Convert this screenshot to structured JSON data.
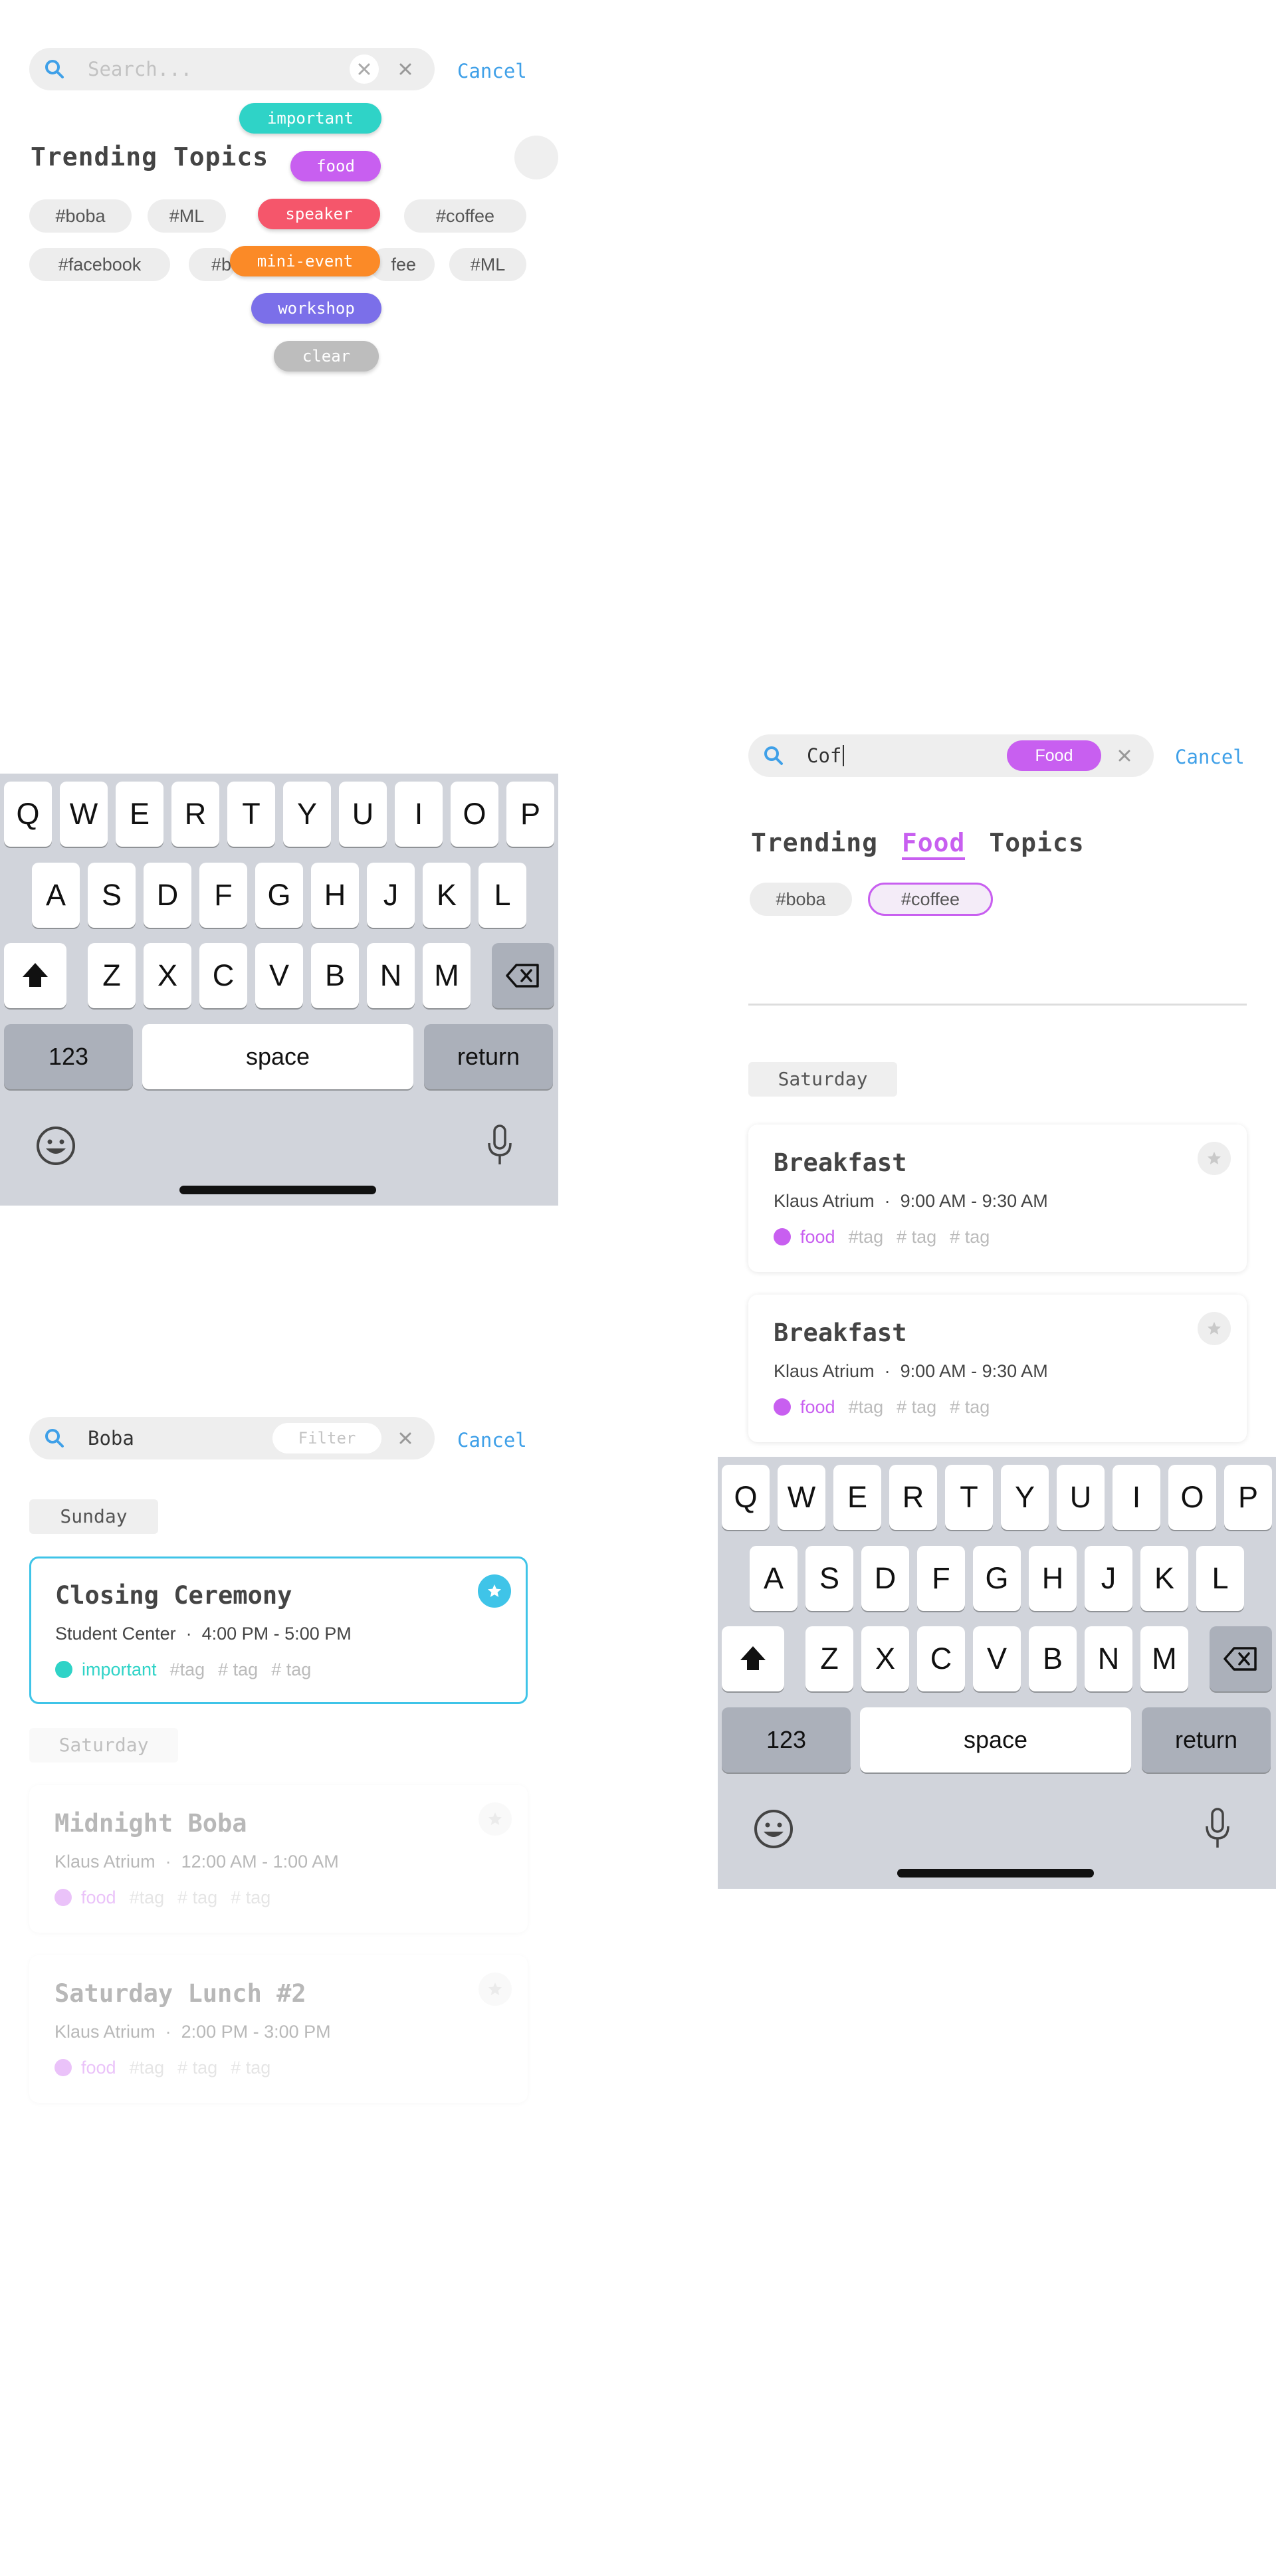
{
  "screen1": {
    "search": {
      "placeholder": "Search...",
      "cancel": "Cancel"
    },
    "title": "Trending Topics",
    "chips": [
      "#boba",
      "#ML",
      "#coffee",
      "#facebook",
      "#b",
      "fee",
      "#ML"
    ],
    "pills": [
      "important",
      "food",
      "speaker",
      "mini-event",
      "workshop",
      "clear"
    ]
  },
  "keyboard": {
    "row1": [
      "Q",
      "W",
      "E",
      "R",
      "T",
      "Y",
      "U",
      "I",
      "O",
      "P"
    ],
    "row2": [
      "A",
      "S",
      "D",
      "F",
      "G",
      "H",
      "J",
      "K",
      "L"
    ],
    "row3": [
      "Z",
      "X",
      "C",
      "V",
      "B",
      "N",
      "M"
    ],
    "numbers": "123",
    "space": "space",
    "return": "return"
  },
  "screen2": {
    "search": {
      "query": "Cof",
      "filter": "Food",
      "cancel": "Cancel"
    },
    "title": {
      "pre": "Trending",
      "highlight": "Food",
      "post": "Topics"
    },
    "chips": [
      "#boba",
      "#coffee"
    ],
    "day": "Saturday",
    "cards": [
      {
        "title": "Breakfast",
        "location": "Klaus Atrium",
        "time": "9:00 AM - 9:30 AM",
        "tag": "food",
        "tags": [
          "#tag",
          "# tag",
          "# tag"
        ]
      },
      {
        "title": "Breakfast",
        "location": "Klaus Atrium",
        "time": "9:00 AM - 9:30 AM",
        "tag": "food",
        "tags": [
          "#tag",
          "# tag",
          "# tag"
        ]
      }
    ]
  },
  "screen3": {
    "search": {
      "query": "Boba",
      "filter": "Filter",
      "cancel": "Cancel"
    },
    "day1": "Sunday",
    "highlight_card": {
      "title": "Closing Ceremony",
      "location": "Student Center",
      "time": "4:00 PM - 5:00 PM",
      "tag": "important",
      "tags": [
        "#tag",
        "# tag",
        "# tag"
      ]
    },
    "day2": "Saturday",
    "cards": [
      {
        "title": "Midnight Boba",
        "location": "Klaus Atrium",
        "time": "12:00 AM - 1:00 AM",
        "tag": "food",
        "tags": [
          "#tag",
          "# tag",
          "# tag"
        ]
      },
      {
        "title": "Saturday Lunch #2",
        "location": "Klaus Atrium",
        "time": "2:00 PM - 3:00 PM",
        "tag": "food",
        "tags": [
          "#tag",
          "# tag",
          "# tag"
        ]
      }
    ]
  },
  "colors": {
    "accent": "#3fa0e8",
    "important": "#2fd3c7",
    "food": "#c85ff0",
    "speaker": "#f5566b",
    "mini_event": "#fb8a27",
    "workshop": "#7b6fe9",
    "clear": "#bdbdbd"
  },
  "icons": {
    "search": "search-icon",
    "clear": "close-icon",
    "star": "star-icon",
    "shift": "shift-icon",
    "delete": "backspace-icon",
    "emoji": "emoji-icon",
    "mic": "microphone-icon"
  }
}
